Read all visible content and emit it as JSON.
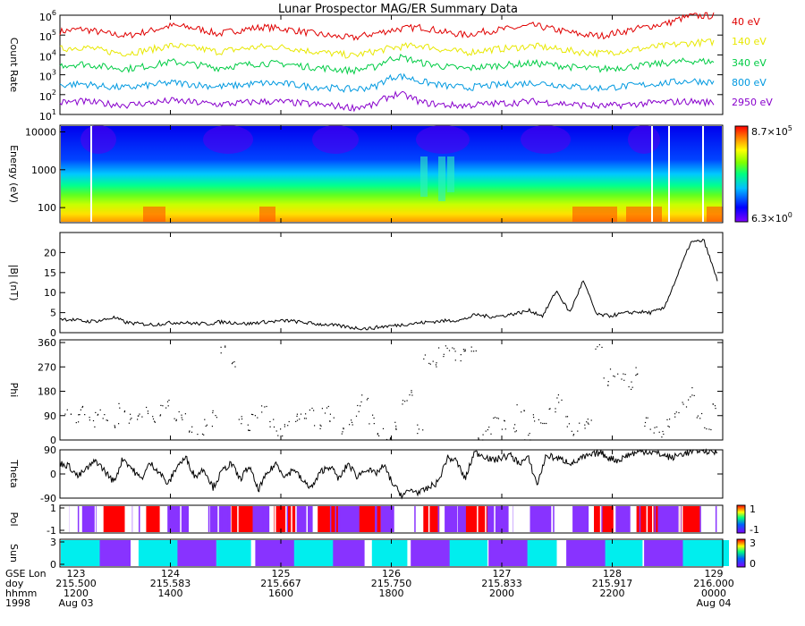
{
  "title": "Lunar Prospector MAG/ER Summary Data",
  "colors": {
    "black": "#000000",
    "red": "#e00000",
    "yellow": "#e8e800",
    "green": "#00cc44",
    "blue": "#0099e0",
    "purple": "#8800cc",
    "cyan": "#00eeee",
    "violet": "#8833ff"
  },
  "chart_data": [
    {
      "id": "count_rate",
      "type": "line",
      "ylabel": "Count Rate",
      "yscale": "log",
      "ylim": [
        10,
        1000000
      ],
      "ytick_labels": [
        "10",
        "10",
        "10",
        "10",
        "10",
        "10"
      ],
      "ytick_exps": [
        "1",
        "2",
        "3",
        "4",
        "5",
        "6"
      ],
      "series": [
        {
          "name": "40 eV",
          "color": "#e00000",
          "values": [
            150000,
            200000,
            120000,
            90000,
            160000,
            300000,
            220000,
            110000,
            180000,
            250000,
            200000,
            130000,
            90000,
            70000,
            120000,
            200000,
            250000,
            140000,
            100000,
            160000,
            210000,
            300000,
            180000,
            110000,
            90000,
            150000,
            250000,
            400000,
            900000,
            950000
          ]
        },
        {
          "name": "140 eV",
          "color": "#e8e800",
          "values": [
            20000,
            25000,
            15000,
            12000,
            18000,
            30000,
            22000,
            14000,
            20000,
            26000,
            24000,
            16000,
            12000,
            9000,
            15000,
            25000,
            30000,
            18000,
            13000,
            18000,
            22000,
            28000,
            20000,
            14000,
            12000,
            16000,
            22000,
            30000,
            40000,
            45000
          ]
        },
        {
          "name": "340 eV",
          "color": "#00cc44",
          "values": [
            3000,
            3500,
            2500,
            2000,
            2800,
            4500,
            3200,
            2200,
            3000,
            3800,
            3500,
            2500,
            2000,
            1600,
            2500,
            8000,
            4000,
            2600,
            2000,
            2700,
            3200,
            3800,
            3000,
            2200,
            1900,
            2400,
            3000,
            4000,
            5000,
            4500
          ]
        },
        {
          "name": "800 eV",
          "color": "#0099e0",
          "values": [
            300,
            350,
            250,
            220,
            300,
            400,
            320,
            250,
            300,
            380,
            350,
            260,
            220,
            180,
            250,
            900,
            450,
            280,
            220,
            280,
            330,
            400,
            320,
            240,
            210,
            260,
            320,
            400,
            500,
            420
          ]
        },
        {
          "name": "2950 eV",
          "color": "#8800cc",
          "values": [
            40,
            45,
            35,
            30,
            38,
            50,
            40,
            32,
            38,
            45,
            42,
            34,
            28,
            22,
            30,
            110,
            40,
            30,
            28,
            34,
            38,
            45,
            38,
            30,
            26,
            30,
            36,
            42,
            45,
            40
          ]
        }
      ]
    },
    {
      "id": "spectrogram",
      "type": "heatmap",
      "ylabel": "Energy (eV)",
      "yscale": "log",
      "ylim": [
        40,
        15000
      ],
      "ytick_labels": [
        "10000",
        "1000",
        "100"
      ],
      "colorbar_labels": [
        "8.7×10",
        "6.3×10"
      ],
      "colorbar_exps": [
        "5",
        "0"
      ],
      "colorscale": [
        "#8000ff",
        "#0000ff",
        "#00c0ff",
        "#00ff80",
        "#80ff00",
        "#ffff00",
        "#ff8000",
        "#ff0000"
      ],
      "zlim": [
        6.3,
        870000
      ]
    },
    {
      "id": "b_mag",
      "type": "line",
      "ylabel": "|B| (nT)",
      "ylim": [
        0,
        25
      ],
      "yticks": [
        0,
        5,
        10,
        15,
        20
      ],
      "ytick_labels": [
        "0",
        "5",
        "10",
        "15",
        "20"
      ],
      "values": [
        3.5,
        3.2,
        2.8,
        3.0,
        3.8,
        2.5,
        2.2,
        2.0,
        2.4,
        2.6,
        2.3,
        2.2,
        2.7,
        2.5,
        2.2,
        2.6,
        2.8,
        3.0,
        2.6,
        2.2,
        2.0,
        1.6,
        1.2,
        1.0,
        1.5,
        1.8,
        2.2,
        2.5,
        2.8,
        3.0,
        3.2,
        4.5,
        4.0,
        4.2,
        4.8,
        5.5,
        4.2,
        10.5,
        5.0,
        13.0,
        4.5,
        4.2,
        4.8,
        5.2,
        5.0,
        6.0,
        14.0,
        22.5,
        23.0,
        13.0
      ]
    },
    {
      "id": "phi",
      "type": "scatter",
      "ylabel": "Phi",
      "ylim": [
        0,
        370
      ],
      "yticks": [
        0,
        90,
        180,
        270,
        360
      ],
      "ytick_labels": [
        "0",
        "90",
        "180",
        "270",
        "360"
      ],
      "values": [
        95,
        85,
        110,
        70,
        100,
        90,
        60,
        120,
        80,
        95,
        105,
        75,
        110,
        130,
        90,
        85,
        40,
        20,
        60,
        100,
        340,
        280,
        80,
        50,
        95,
        110,
        70,
        30,
        55,
        90,
        80,
        100,
        60,
        120,
        90,
        40,
        75,
        110,
        160,
        80,
        30,
        10,
        60,
        140,
        170,
        40,
        300,
        290,
        330,
        350,
        310,
        320,
        340,
        10,
        30,
        80,
        60,
        40,
        120,
        20,
        90,
        50,
        100,
        160,
        70,
        30,
        50,
        80,
        350,
        220,
        250,
        230,
        200,
        260,
        70,
        40,
        30,
        60,
        90,
        140,
        180,
        100,
        60,
        120
      ]
    },
    {
      "id": "theta",
      "type": "line",
      "ylabel": "Theta",
      "ylim": [
        -90,
        90
      ],
      "yticks": [
        -90,
        0,
        90
      ],
      "ytick_labels": [
        "-90",
        "0",
        "90"
      ],
      "values": [
        40,
        30,
        -10,
        20,
        50,
        10,
        -30,
        60,
        20,
        -20,
        40,
        10,
        -40,
        30,
        60,
        -10,
        20,
        -50,
        10,
        40,
        -20,
        30,
        -60,
        0,
        40,
        -10,
        20,
        -30,
        -50,
        10,
        30,
        -20,
        40,
        -10,
        20,
        0,
        30,
        -40,
        -80,
        -60,
        -70,
        -50,
        -30,
        60,
        50,
        -20,
        80,
        70,
        50,
        60,
        70,
        40,
        60,
        -40,
        70,
        60,
        50,
        40,
        60,
        70,
        80,
        60,
        50,
        70,
        80,
        85,
        80,
        70,
        60,
        75,
        80,
        90,
        85,
        80
      ]
    },
    {
      "id": "pol",
      "type": "categorical",
      "ylabel": "Pol",
      "cbar_min": "-1",
      "cbar_max": "1",
      "segments": [
        "#ffffff",
        "#8833ff",
        "#ff0000",
        "#ffffff",
        "#ff0000",
        "#8833ff",
        "#ffffff",
        "#8833ff",
        "#ff0000",
        "#8833ff",
        "#ff0000",
        "#8833ff",
        "#ff0000",
        "#8833ff",
        "#ff0000",
        "#8833ff",
        "#ffffff",
        "#ff0000",
        "#8833ff",
        "#ff0000",
        "#8833ff",
        "#ffffff",
        "#8833ff",
        "#ffffff",
        "#8833ff",
        "#ff0000",
        "#8833ff",
        "#ff0000",
        "#8833ff",
        "#ff0000",
        "#ffffff"
      ]
    },
    {
      "id": "sun",
      "type": "categorical",
      "ylabel": "Sun",
      "cbar_min": "0",
      "cbar_max": "3",
      "segments": [
        "#00eeee",
        "#8833ff",
        "#00eeee",
        "#8833ff",
        "#00eeee",
        "#8833ff",
        "#00eeee",
        "#8833ff",
        "#00eeee",
        "#8833ff",
        "#00eeee",
        "#8833ff",
        "#00eeee",
        "#8833ff",
        "#00eeee",
        "#8833ff",
        "#00eeee"
      ]
    }
  ],
  "time_axis": {
    "row_labels": [
      "GSE Lon",
      "doy",
      "hhmm",
      "1998"
    ],
    "ticks": [
      {
        "lon": "123",
        "doy": "215.500",
        "hhmm": "1200",
        "date": "Aug 03"
      },
      {
        "lon": "124",
        "doy": "215.583",
        "hhmm": "1400",
        "date": ""
      },
      {
        "lon": "125",
        "doy": "215.667",
        "hhmm": "1600",
        "date": ""
      },
      {
        "lon": "126",
        "doy": "215.750",
        "hhmm": "1800",
        "date": ""
      },
      {
        "lon": "127",
        "doy": "215.833",
        "hhmm": "2000",
        "date": ""
      },
      {
        "lon": "128",
        "doy": "215.917",
        "hhmm": "2200",
        "date": ""
      },
      {
        "lon": "129",
        "doy": "216.000",
        "hhmm": "0000",
        "date": "Aug 04"
      }
    ]
  }
}
